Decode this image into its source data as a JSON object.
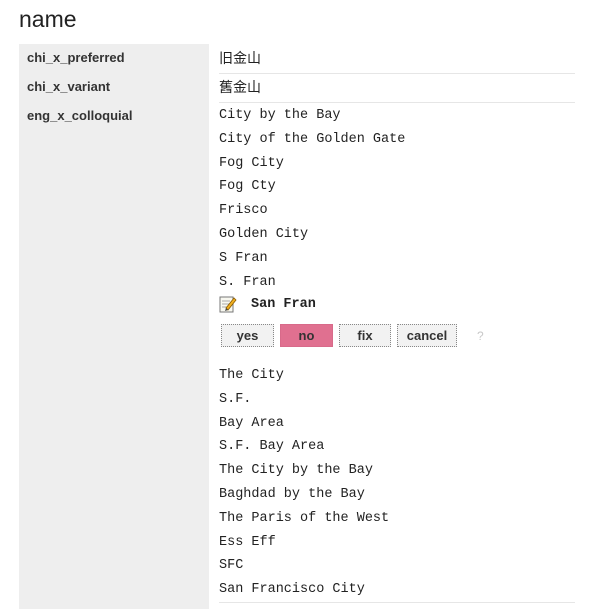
{
  "title": "name",
  "rows": [
    {
      "label": "chi_x_preferred",
      "value": "旧金山"
    },
    {
      "label": "chi_x_variant",
      "value": "舊金山"
    },
    {
      "label": "eng_x_colloquial"
    }
  ],
  "colloquial_before": [
    "City by the Bay",
    "City of the Golden Gate",
    "Fog City",
    "Fog Cty",
    "Frisco",
    "Golden City",
    "S Fran",
    "S. Fran"
  ],
  "editing": {
    "icon": "edit-icon",
    "value": "San Fran",
    "buttons": {
      "yes": "yes",
      "no": "no",
      "fix": "fix",
      "cancel": "cancel"
    },
    "help": "?"
  },
  "colloquial_after": [
    "The City",
    "S.F.",
    "Bay Area",
    "S.F. Bay Area",
    "The City by the Bay",
    "Baghdad by the Bay",
    "The Paris of the West",
    "Ess Eff",
    "SFC",
    "San Francisco City"
  ],
  "colors": {
    "no_button": "#e07090",
    "label_bg": "#eeeeee"
  }
}
